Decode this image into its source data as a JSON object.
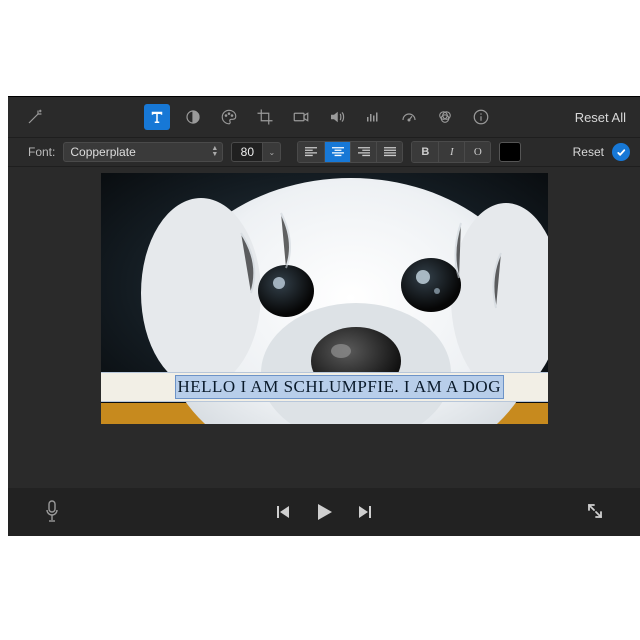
{
  "toolbar": {
    "reset_all": "Reset All",
    "tabs": [
      "magic-wand",
      "text",
      "levels",
      "color-palette",
      "crop",
      "camera",
      "volume",
      "equalizer",
      "speed",
      "color-balance",
      "info"
    ],
    "active_tab": "text"
  },
  "text_panel": {
    "font_label": "Font:",
    "font_name": "Copperplate",
    "font_size": "80",
    "align": [
      "left",
      "center",
      "right",
      "justify"
    ],
    "align_active": "center",
    "style_buttons": {
      "bold": "B",
      "italic": "I",
      "outline": "O"
    },
    "color": "#000000",
    "reset": "Reset"
  },
  "preview": {
    "title_text": "HELLO I AM SCHLUMPFIE. I AM A DOG"
  },
  "playback": {
    "buttons": [
      "prev",
      "play",
      "next"
    ]
  }
}
